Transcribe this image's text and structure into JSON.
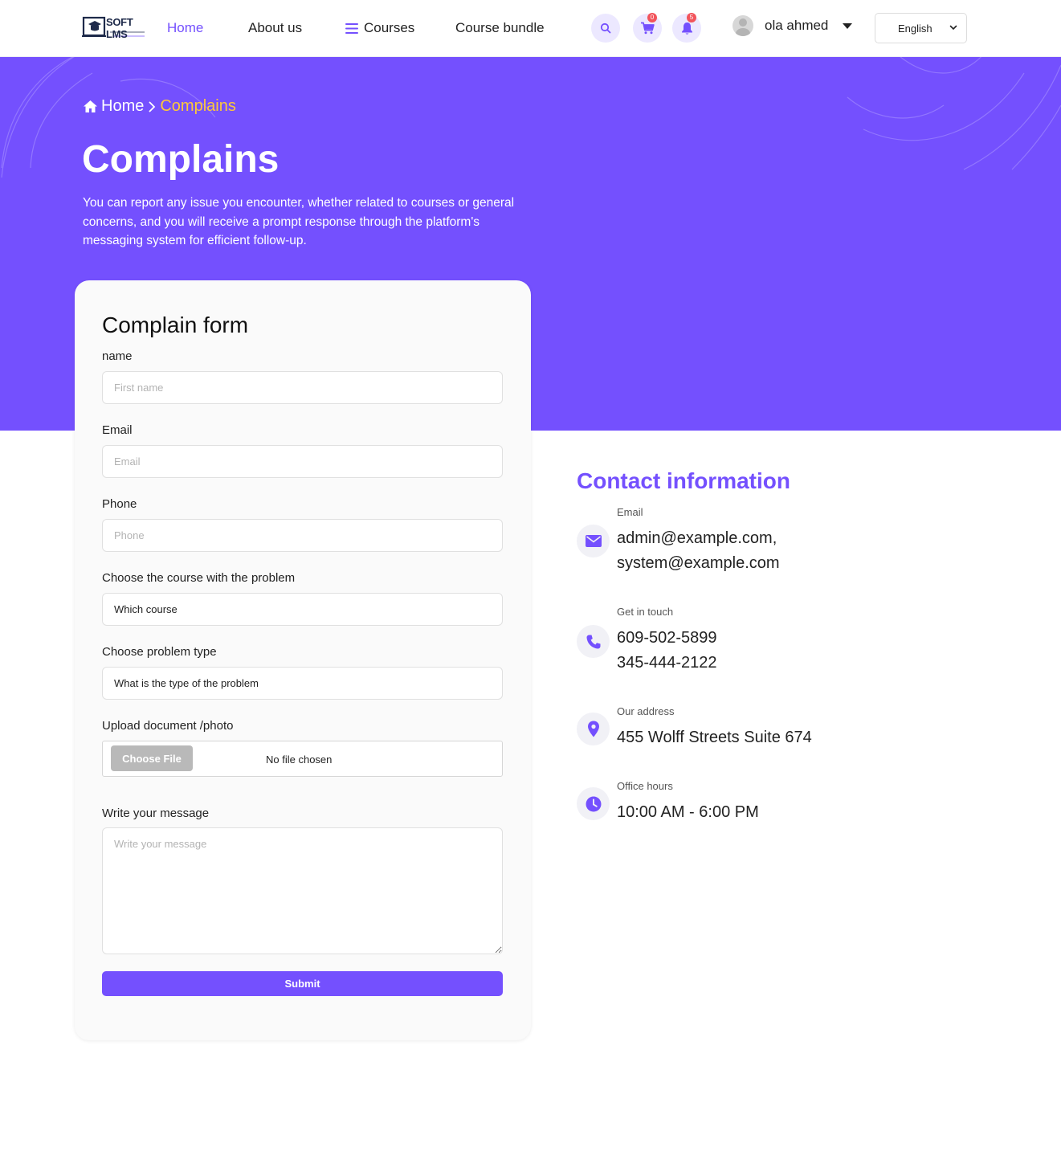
{
  "colors": {
    "brand": "#7450fe",
    "accent_yellow": "#fdc83a",
    "badge_red": "#f2545b",
    "icon_bg": "#ece8ff"
  },
  "header": {
    "logo_text": "SOFT LMS",
    "nav": {
      "home": "Home",
      "about": "About us",
      "courses": "Courses",
      "bundle": "Course bundle"
    },
    "cart_count": "0",
    "notification_count": "5",
    "user_name": "ola ahmed",
    "language": "English",
    "icons": {
      "search": "search-icon",
      "cart": "cart-icon",
      "bell": "bell-icon",
      "menu": "hamburger-icon",
      "caret": "caret-down-icon",
      "chevron": "chevron-down-icon"
    }
  },
  "hero": {
    "breadcrumb_home": "Home",
    "breadcrumb_separator": ">",
    "breadcrumb_current": "Complains",
    "title": "Complains",
    "description": "You can report any issue you encounter, whether related to courses or general concerns, and you will receive a prompt response through the platform's messaging system for efficient follow-up."
  },
  "form": {
    "title": "Complain form",
    "name_label": "name",
    "name_placeholder": "First name",
    "email_label": "Email",
    "email_placeholder": "Email",
    "phone_label": "Phone",
    "phone_placeholder": "Phone",
    "course_label": "Choose the course with the problem",
    "course_value": "Which course",
    "problem_label": "Choose problem type",
    "problem_value": "What is the type of the problem",
    "upload_label": "Upload document /photo",
    "upload_button": "Choose File",
    "upload_status": "No file chosen",
    "message_label": "Write your message",
    "message_placeholder": "Write your message",
    "submit_label": "Submit"
  },
  "contact": {
    "title": "Contact information",
    "email": {
      "label": "Email",
      "line1": "admin@example.com,",
      "line2": "system@example.com",
      "icon": "envelope-icon"
    },
    "phone": {
      "label": "Get in touch",
      "line1": "609-502-5899",
      "line2": "345-444-2122",
      "icon": "phone-icon"
    },
    "address": {
      "label": "Our address",
      "line1": "455 Wolff Streets Suite 674",
      "icon": "location-pin-icon"
    },
    "hours": {
      "label": "Office hours",
      "line1": "10:00 AM - 6:00 PM",
      "icon": "clock-icon"
    }
  }
}
